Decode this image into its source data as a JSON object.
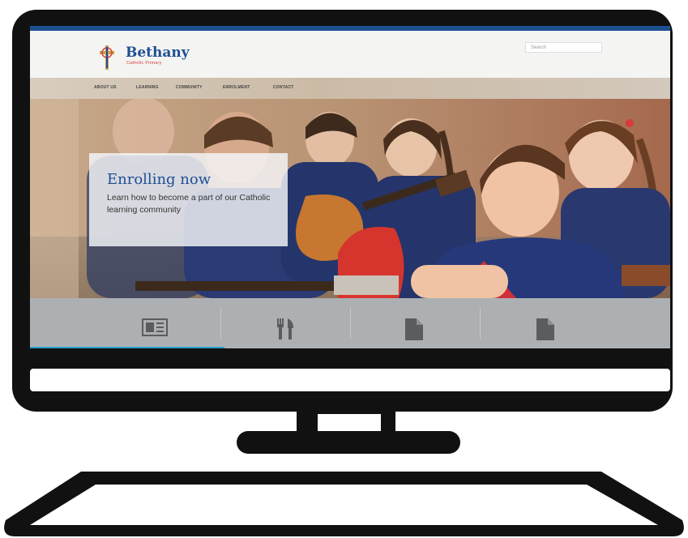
{
  "site": {
    "name": "Bethany",
    "tagline": "Catholic Primary",
    "search_placeholder": "Search"
  },
  "nav": {
    "items": [
      "ABOUT US",
      "LEARNING",
      "COMMUNITY",
      "ENROLMENT",
      "CONTACT"
    ]
  },
  "hero": {
    "title": "Enrolling now",
    "text": "Learn how to become a part of our Catholic learning community"
  },
  "features": {
    "icons": [
      "newsletter-icon",
      "canteen-icon",
      "document-icon",
      "document-icon"
    ]
  },
  "colors": {
    "brand_blue": "#1f4f94",
    "accent_red": "#d24040",
    "feature_bar": "#adb0b3",
    "monitor": "#111111"
  }
}
